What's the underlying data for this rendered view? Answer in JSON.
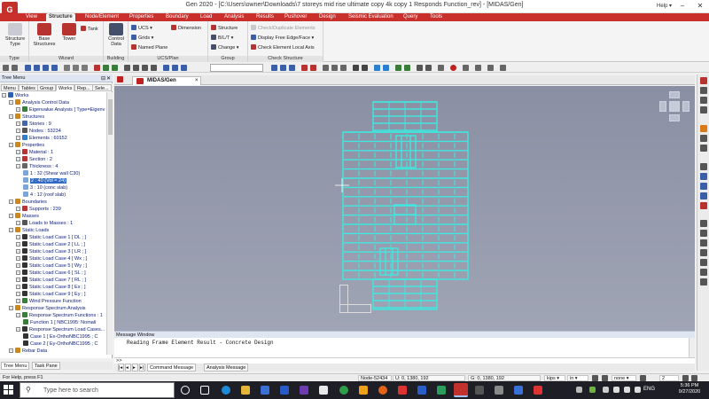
{
  "window": {
    "title": "Gen 2020 - [C:\\Users\\owner\\Downloads\\7 storeys mid rise ultimate copy 4k copy 1 Responds Function_rev] - [MIDAS/Gen]",
    "app_icon_letter": "G",
    "help_label": "Help"
  },
  "menu": {
    "tabs": [
      "View",
      "Structure",
      "Node/Element",
      "Properties",
      "Boundary",
      "Load",
      "Analysis",
      "Results",
      "Pushover",
      "Design",
      "Seismic Evaluation",
      "Query",
      "Tools"
    ],
    "active": "Structure"
  },
  "ribbon": {
    "groups": [
      {
        "label": "Type",
        "buttons": [
          "Structure Type"
        ]
      },
      {
        "label": "Wizard",
        "buttons": [
          "Base Structures",
          "Tower",
          "Tank"
        ]
      },
      {
        "label": "Building",
        "buttons": [
          "Control Data"
        ]
      },
      {
        "label": "UCS/Plan",
        "buttons": [
          "UCS",
          "Grids",
          "Named Plane",
          "Dimension"
        ]
      },
      {
        "label": "Group",
        "buttons": [
          "Structure",
          "B/L/T",
          "Change"
        ]
      },
      {
        "label": "Check Structure",
        "buttons": [
          "Check/Duplicate Elements",
          "Display Free Edge/Face",
          "Check Element Local Axis"
        ]
      }
    ]
  },
  "tree": {
    "header": "Tree Menu",
    "tabs": [
      "Menu",
      "Tables",
      "Group",
      "Works",
      "Rep...",
      "Sele..."
    ],
    "active_tab": "Works",
    "rows": [
      {
        "text": "Works",
        "level": 0,
        "icon": "works-icon",
        "color": "#2d5fb8"
      },
      {
        "text": "Analysis Control Data",
        "level": 1,
        "icon": "folder-icon",
        "color": "#c98a1b"
      },
      {
        "text": "Eigenvalue Analysis [ Type=Eigenv",
        "level": 2,
        "icon": "analysis-icon",
        "color": "#3a7d3a"
      },
      {
        "text": "Structures",
        "level": 1,
        "icon": "folder-icon",
        "color": "#c98a1b"
      },
      {
        "text": "Stories : 9",
        "level": 2,
        "icon": "story-icon",
        "color": "#4466aa"
      },
      {
        "text": "Nodes : 53234",
        "level": 2,
        "icon": "node-icon",
        "color": "#555555"
      },
      {
        "text": "Elements : 60152",
        "level": 2,
        "icon": "element-icon",
        "color": "#2f7fd0"
      },
      {
        "text": "Properties",
        "level": 1,
        "icon": "folder-icon",
        "color": "#c98a1b"
      },
      {
        "text": "Material : 1",
        "level": 2,
        "icon": "material-icon",
        "color": "#b33"
      },
      {
        "text": "Section : 2",
        "level": 2,
        "icon": "section-icon",
        "color": "#b33"
      },
      {
        "text": "Thickness : 4",
        "level": 2,
        "icon": "thickness-icon",
        "color": "#666"
      },
      {
        "text": "1 : 32 (Shear wall C30)",
        "level": 3,
        "icon": "plate-icon",
        "color": "#7aa7d8"
      },
      {
        "text": "2 : 40 (Vol = 24)",
        "level": 3,
        "icon": "plate-icon",
        "color": "#7aa7d8",
        "selected": true
      },
      {
        "text": "3 : 10 (conc slab)",
        "level": 3,
        "icon": "plate-icon",
        "color": "#7aa7d8"
      },
      {
        "text": "4 : 12 (roof slab)",
        "level": 3,
        "icon": "plate-icon",
        "color": "#7aa7d8"
      },
      {
        "text": "Boundaries",
        "level": 1,
        "icon": "folder-icon",
        "color": "#c98a1b"
      },
      {
        "text": "Supports : 239",
        "level": 2,
        "icon": "support-icon",
        "color": "#b33"
      },
      {
        "text": "Masses",
        "level": 1,
        "icon": "folder-icon",
        "color": "#c98a1b"
      },
      {
        "text": "Loads to Masses : 1",
        "level": 2,
        "icon": "mass-icon",
        "color": "#555"
      },
      {
        "text": "Static Loads",
        "level": 1,
        "icon": "folder-icon",
        "color": "#c98a1b"
      },
      {
        "text": "Static Load Case 1 [ DL ; ]",
        "level": 2,
        "icon": "loadcase-icon",
        "color": "#333"
      },
      {
        "text": "Static Load Case 2 [ LL ; ]",
        "level": 2,
        "icon": "loadcase-icon",
        "color": "#333"
      },
      {
        "text": "Static Load Case 3 [ LR ; ]",
        "level": 2,
        "icon": "loadcase-icon",
        "color": "#333"
      },
      {
        "text": "Static Load Case 4 [ Wx ; ]",
        "level": 2,
        "icon": "loadcase-icon",
        "color": "#333"
      },
      {
        "text": "Static Load Case 5 [ Wy ; ]",
        "level": 2,
        "icon": "loadcase-icon",
        "color": "#333"
      },
      {
        "text": "Static Load Case 6 [ SL ; ]",
        "level": 2,
        "icon": "loadcase-icon",
        "color": "#333"
      },
      {
        "text": "Static Load Case 7 [ RL ; ]",
        "level": 2,
        "icon": "loadcase-icon",
        "color": "#333"
      },
      {
        "text": "Static Load Case 8 [ Ex ; ]",
        "level": 2,
        "icon": "loadcase-icon",
        "color": "#333"
      },
      {
        "text": "Static Load Case 9 [ Ey ; ]",
        "level": 2,
        "icon": "loadcase-icon",
        "color": "#333"
      },
      {
        "text": "Wind Pressure Function",
        "level": 2,
        "icon": "wind-icon",
        "color": "#3a7d3a"
      },
      {
        "text": "Response Spectrum Analysis",
        "level": 1,
        "icon": "folder-icon",
        "color": "#c98a1b"
      },
      {
        "text": "Response Spectrum Functions : 1",
        "level": 2,
        "icon": "function-icon",
        "color": "#3a7d3a"
      },
      {
        "text": "Function 1 [ NBC1995: Nomali",
        "level": 3,
        "icon": "function-icon",
        "color": "#3a7d3a"
      },
      {
        "text": "Response Spectrum Load Cases...",
        "level": 2,
        "icon": "loadcase-icon",
        "color": "#333"
      },
      {
        "text": "Case 1 [ Ex-OrthoNBC1995 ; C",
        "level": 3,
        "icon": "loadcase-icon",
        "color": "#333"
      },
      {
        "text": "Case 2 [ Ey-OrthoNBC1995 ; C",
        "level": 3,
        "icon": "loadcase-icon",
        "color": "#333"
      },
      {
        "text": "Rebar Data",
        "level": 1,
        "icon": "folder-icon",
        "color": "#c98a1b"
      }
    ],
    "bottom_tabs": [
      "Tree Menu",
      "Task Pane"
    ]
  },
  "view": {
    "tab_label": "MIDAS/Gen"
  },
  "message": {
    "header": "Message Window",
    "text": "Reading Frame Element Result - Concrete Design",
    "prompt": ">>",
    "tabs": [
      "Command Message",
      "Analysis Message"
    ]
  },
  "status": {
    "help": "For Help, press F1",
    "node": "Node-52434",
    "u_coord": "U: 0, 1380, 192",
    "g_coord": "G: 0, 1380, 192",
    "unit_force": "kips",
    "unit_length": "in",
    "none_label": "none",
    "page": "2"
  },
  "taskbar": {
    "search_placeholder": "Type here to search",
    "lang": "ENG",
    "time": "5:36 PM",
    "date": "9/27/2020"
  }
}
